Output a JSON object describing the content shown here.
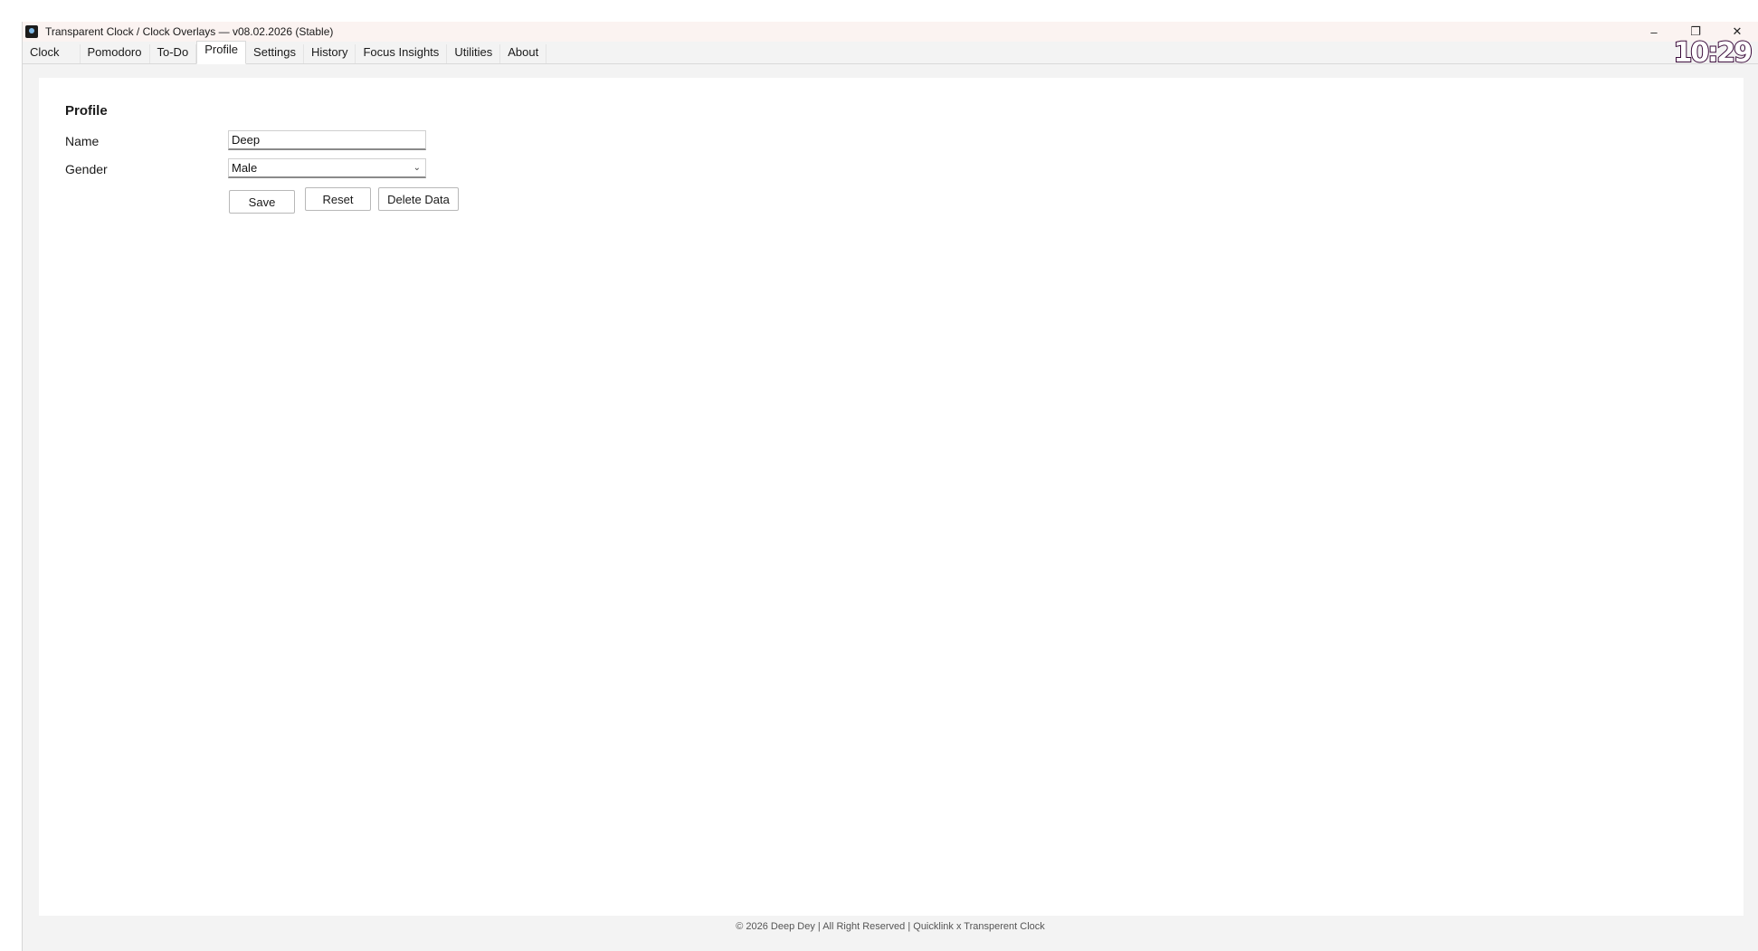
{
  "window": {
    "title": "Transparent Clock / Clock Overlays — v08.02.2026 (Stable)",
    "controls": {
      "minimize": "–",
      "restore": "❐",
      "close": "✕"
    }
  },
  "tabs": [
    {
      "label": "Clock"
    },
    {
      "label": "Pomodoro"
    },
    {
      "label": "To-Do"
    },
    {
      "label": "Profile",
      "active": true
    },
    {
      "label": "Settings"
    },
    {
      "label": "History"
    },
    {
      "label": "Focus Insights"
    },
    {
      "label": "Utilities"
    },
    {
      "label": "About"
    }
  ],
  "overlay_clock": "10:29",
  "profile": {
    "heading": "Profile",
    "name_label": "Name",
    "name_value": "Deep",
    "gender_label": "Gender",
    "gender_value": "Male",
    "buttons": {
      "save": "Save",
      "reset": "Reset",
      "delete": "Delete Data"
    }
  },
  "footer": "© 2026 Deep Dey | All Right Reserved | Quicklink x Transperent Clock",
  "icons": {
    "app": "app-icon",
    "minimize": "minimize-icon",
    "restore": "restore-icon",
    "close": "close-icon",
    "dropdown": "chevron-down-icon"
  }
}
